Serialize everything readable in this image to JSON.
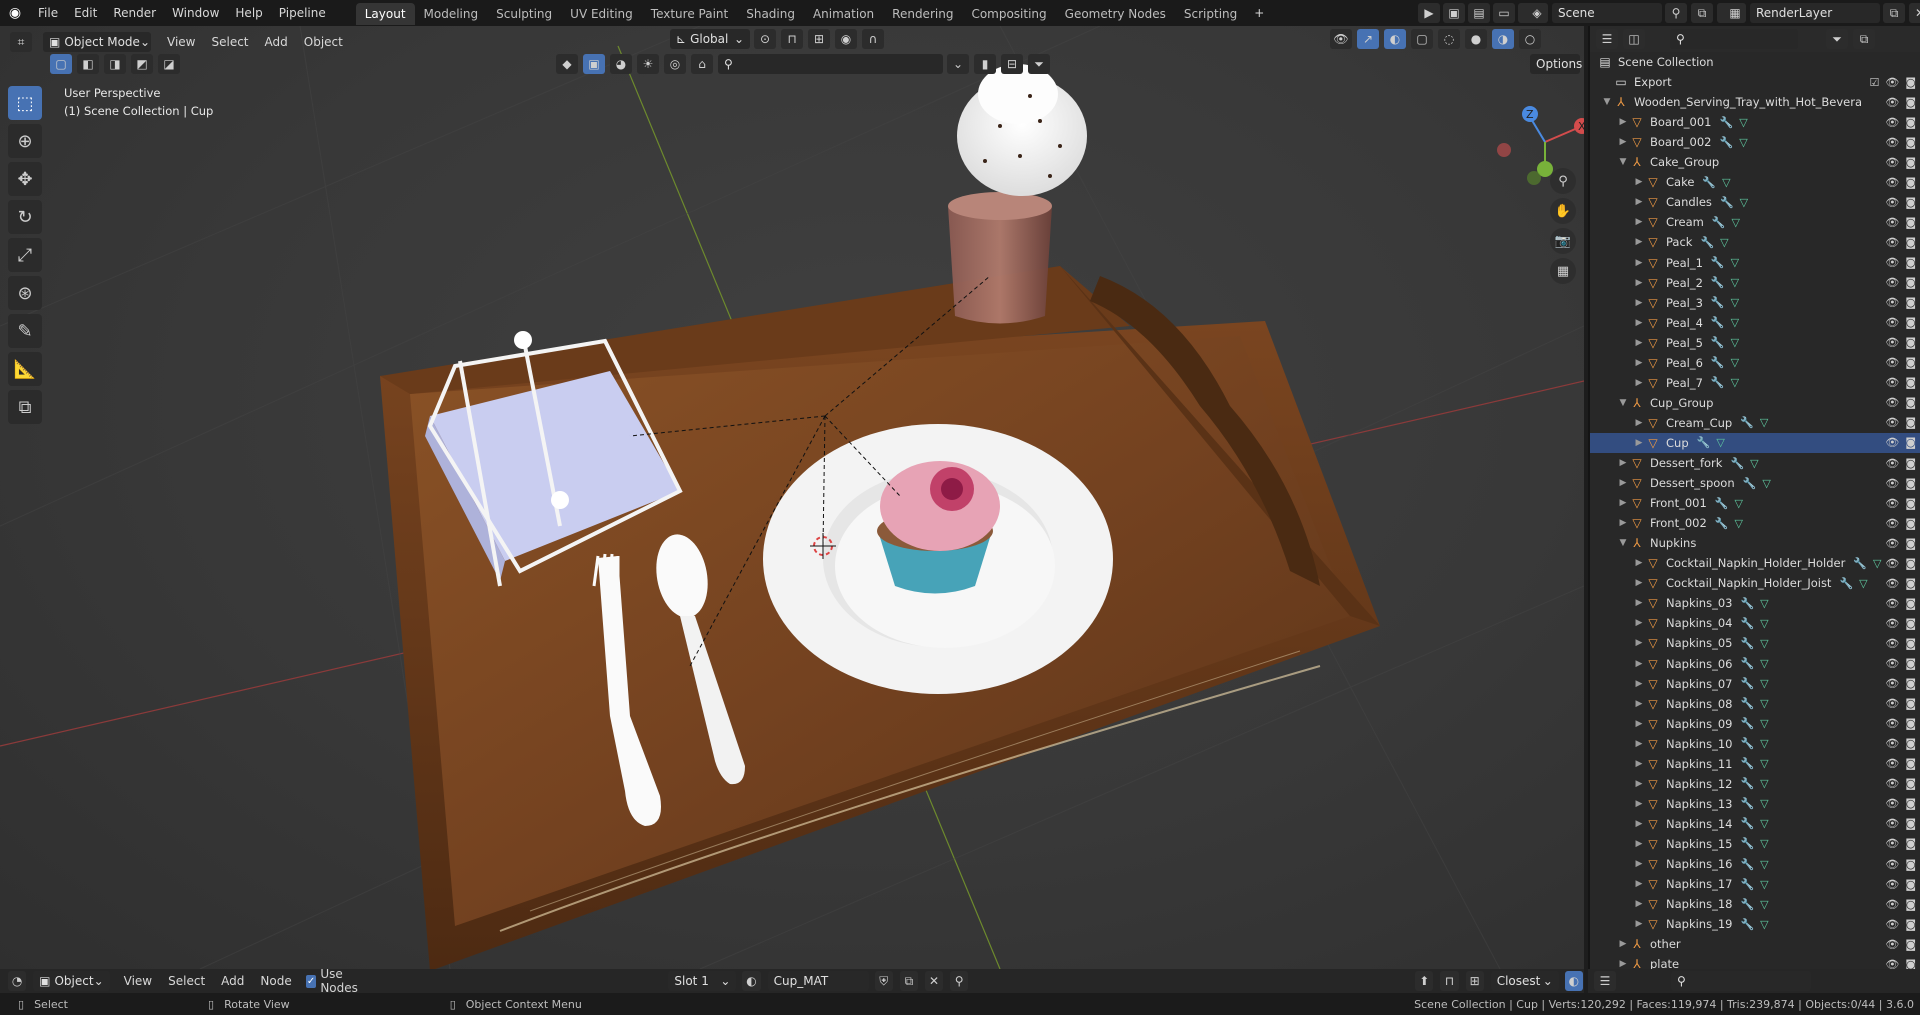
{
  "menubar": {
    "menus": [
      "File",
      "Edit",
      "Render",
      "Window",
      "Help",
      "Pipeline"
    ],
    "workspaces": [
      "Layout",
      "Modeling",
      "Sculpting",
      "UV Editing",
      "Texture Paint",
      "Shading",
      "Animation",
      "Rendering",
      "Compositing",
      "Geometry Nodes",
      "Scripting"
    ],
    "active_workspace": "Layout",
    "add_tab": "+",
    "scene": "Scene",
    "view_layer": "RenderLayer"
  },
  "viewport_header": {
    "mode": "Object Mode",
    "menus": [
      "View",
      "Select",
      "Add",
      "Object"
    ],
    "transform_orientation": "Global",
    "options": "Options"
  },
  "viewport": {
    "perspective": "User Perspective",
    "collection_info": "(1) Scene Collection | Cup",
    "axes": {
      "x": "X",
      "y": "Y",
      "z": "Z"
    }
  },
  "outliner": {
    "root": "Scene Collection",
    "rows": [
      {
        "name": "Export",
        "depth": 1,
        "type": "collection",
        "expanded": true
      },
      {
        "name": "Wooden_Serving_Tray_with_Hot_Bevera",
        "depth": 1,
        "type": "empty",
        "expanded": true
      },
      {
        "name": "Board_001",
        "depth": 2,
        "type": "mesh"
      },
      {
        "name": "Board_002",
        "depth": 2,
        "type": "mesh"
      },
      {
        "name": "Cake_Group",
        "depth": 2,
        "type": "empty",
        "expanded": true
      },
      {
        "name": "Cake",
        "depth": 3,
        "type": "mesh"
      },
      {
        "name": "Candles",
        "depth": 3,
        "type": "mesh"
      },
      {
        "name": "Cream",
        "depth": 3,
        "type": "mesh"
      },
      {
        "name": "Pack",
        "depth": 3,
        "type": "mesh"
      },
      {
        "name": "Peal_1",
        "depth": 3,
        "type": "mesh"
      },
      {
        "name": "Peal_2",
        "depth": 3,
        "type": "mesh"
      },
      {
        "name": "Peal_3",
        "depth": 3,
        "type": "mesh"
      },
      {
        "name": "Peal_4",
        "depth": 3,
        "type": "mesh"
      },
      {
        "name": "Peal_5",
        "depth": 3,
        "type": "mesh"
      },
      {
        "name": "Peal_6",
        "depth": 3,
        "type": "mesh"
      },
      {
        "name": "Peal_7",
        "depth": 3,
        "type": "mesh"
      },
      {
        "name": "Cup_Group",
        "depth": 2,
        "type": "empty",
        "expanded": true
      },
      {
        "name": "Cream_Cup",
        "depth": 3,
        "type": "mesh"
      },
      {
        "name": "Cup",
        "depth": 3,
        "type": "mesh",
        "selected": true
      },
      {
        "name": "Dessert_fork",
        "depth": 2,
        "type": "mesh"
      },
      {
        "name": "Dessert_spoon",
        "depth": 2,
        "type": "mesh"
      },
      {
        "name": "Front_001",
        "depth": 2,
        "type": "mesh"
      },
      {
        "name": "Front_002",
        "depth": 2,
        "type": "mesh"
      },
      {
        "name": "Nupkins",
        "depth": 2,
        "type": "empty",
        "expanded": true
      },
      {
        "name": "Cocktail_Napkin_Holder_Holder",
        "depth": 3,
        "type": "mesh"
      },
      {
        "name": "Cocktail_Napkin_Holder_Joist",
        "depth": 3,
        "type": "mesh"
      },
      {
        "name": "Napkins_03",
        "depth": 3,
        "type": "mesh"
      },
      {
        "name": "Napkins_04",
        "depth": 3,
        "type": "mesh"
      },
      {
        "name": "Napkins_05",
        "depth": 3,
        "type": "mesh"
      },
      {
        "name": "Napkins_06",
        "depth": 3,
        "type": "mesh"
      },
      {
        "name": "Napkins_07",
        "depth": 3,
        "type": "mesh"
      },
      {
        "name": "Napkins_08",
        "depth": 3,
        "type": "mesh"
      },
      {
        "name": "Napkins_09",
        "depth": 3,
        "type": "mesh"
      },
      {
        "name": "Napkins_10",
        "depth": 3,
        "type": "mesh"
      },
      {
        "name": "Napkins_11",
        "depth": 3,
        "type": "mesh"
      },
      {
        "name": "Napkins_12",
        "depth": 3,
        "type": "mesh"
      },
      {
        "name": "Napkins_13",
        "depth": 3,
        "type": "mesh"
      },
      {
        "name": "Napkins_14",
        "depth": 3,
        "type": "mesh"
      },
      {
        "name": "Napkins_15",
        "depth": 3,
        "type": "mesh"
      },
      {
        "name": "Napkins_16",
        "depth": 3,
        "type": "mesh"
      },
      {
        "name": "Napkins_17",
        "depth": 3,
        "type": "mesh"
      },
      {
        "name": "Napkins_18",
        "depth": 3,
        "type": "mesh"
      },
      {
        "name": "Napkins_19",
        "depth": 3,
        "type": "mesh"
      },
      {
        "name": "other",
        "depth": 2,
        "type": "empty"
      },
      {
        "name": "plate",
        "depth": 2,
        "type": "empty"
      }
    ]
  },
  "node_header": {
    "object": "Object",
    "menus": [
      "View",
      "Select",
      "Add",
      "Node"
    ],
    "use_nodes": "Use Nodes",
    "slot": "Slot 1",
    "material": "Cup_MAT",
    "interpolation": "Closest"
  },
  "statusbar": {
    "select": "Select",
    "rotate": "Rotate View",
    "context": "Object Context Menu",
    "stats": "Scene Collection | Cup | Verts:120,292 | Faces:119,974 | Tris:239,874 | Objects:0/44 | 3.6.0"
  }
}
